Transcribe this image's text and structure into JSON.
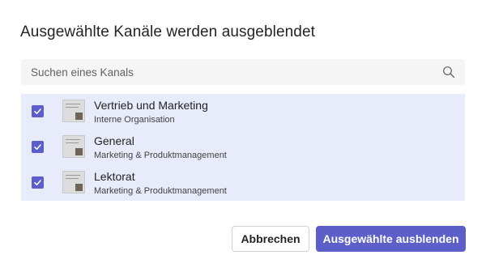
{
  "dialog": {
    "title": "Ausgewählte Kanäle werden ausgeblendet"
  },
  "search": {
    "placeholder": "Suchen eines Kanals",
    "icon": "search-icon"
  },
  "channels": [
    {
      "name": "Vertrieb und Marketing",
      "team": "Interne Organisation",
      "checked": true
    },
    {
      "name": "General",
      "team": "Marketing & Produktmanagement",
      "checked": true
    },
    {
      "name": "Lektorat",
      "team": "Marketing & Produktmanagement",
      "checked": true
    }
  ],
  "buttons": {
    "cancel_label": "Abbrechen",
    "confirm_label": "Ausgewählte ausblenden"
  },
  "colors": {
    "accent": "#5b5fc7",
    "selected_row_bg": "#e8ebfa",
    "search_bg": "#f5f5f5"
  }
}
